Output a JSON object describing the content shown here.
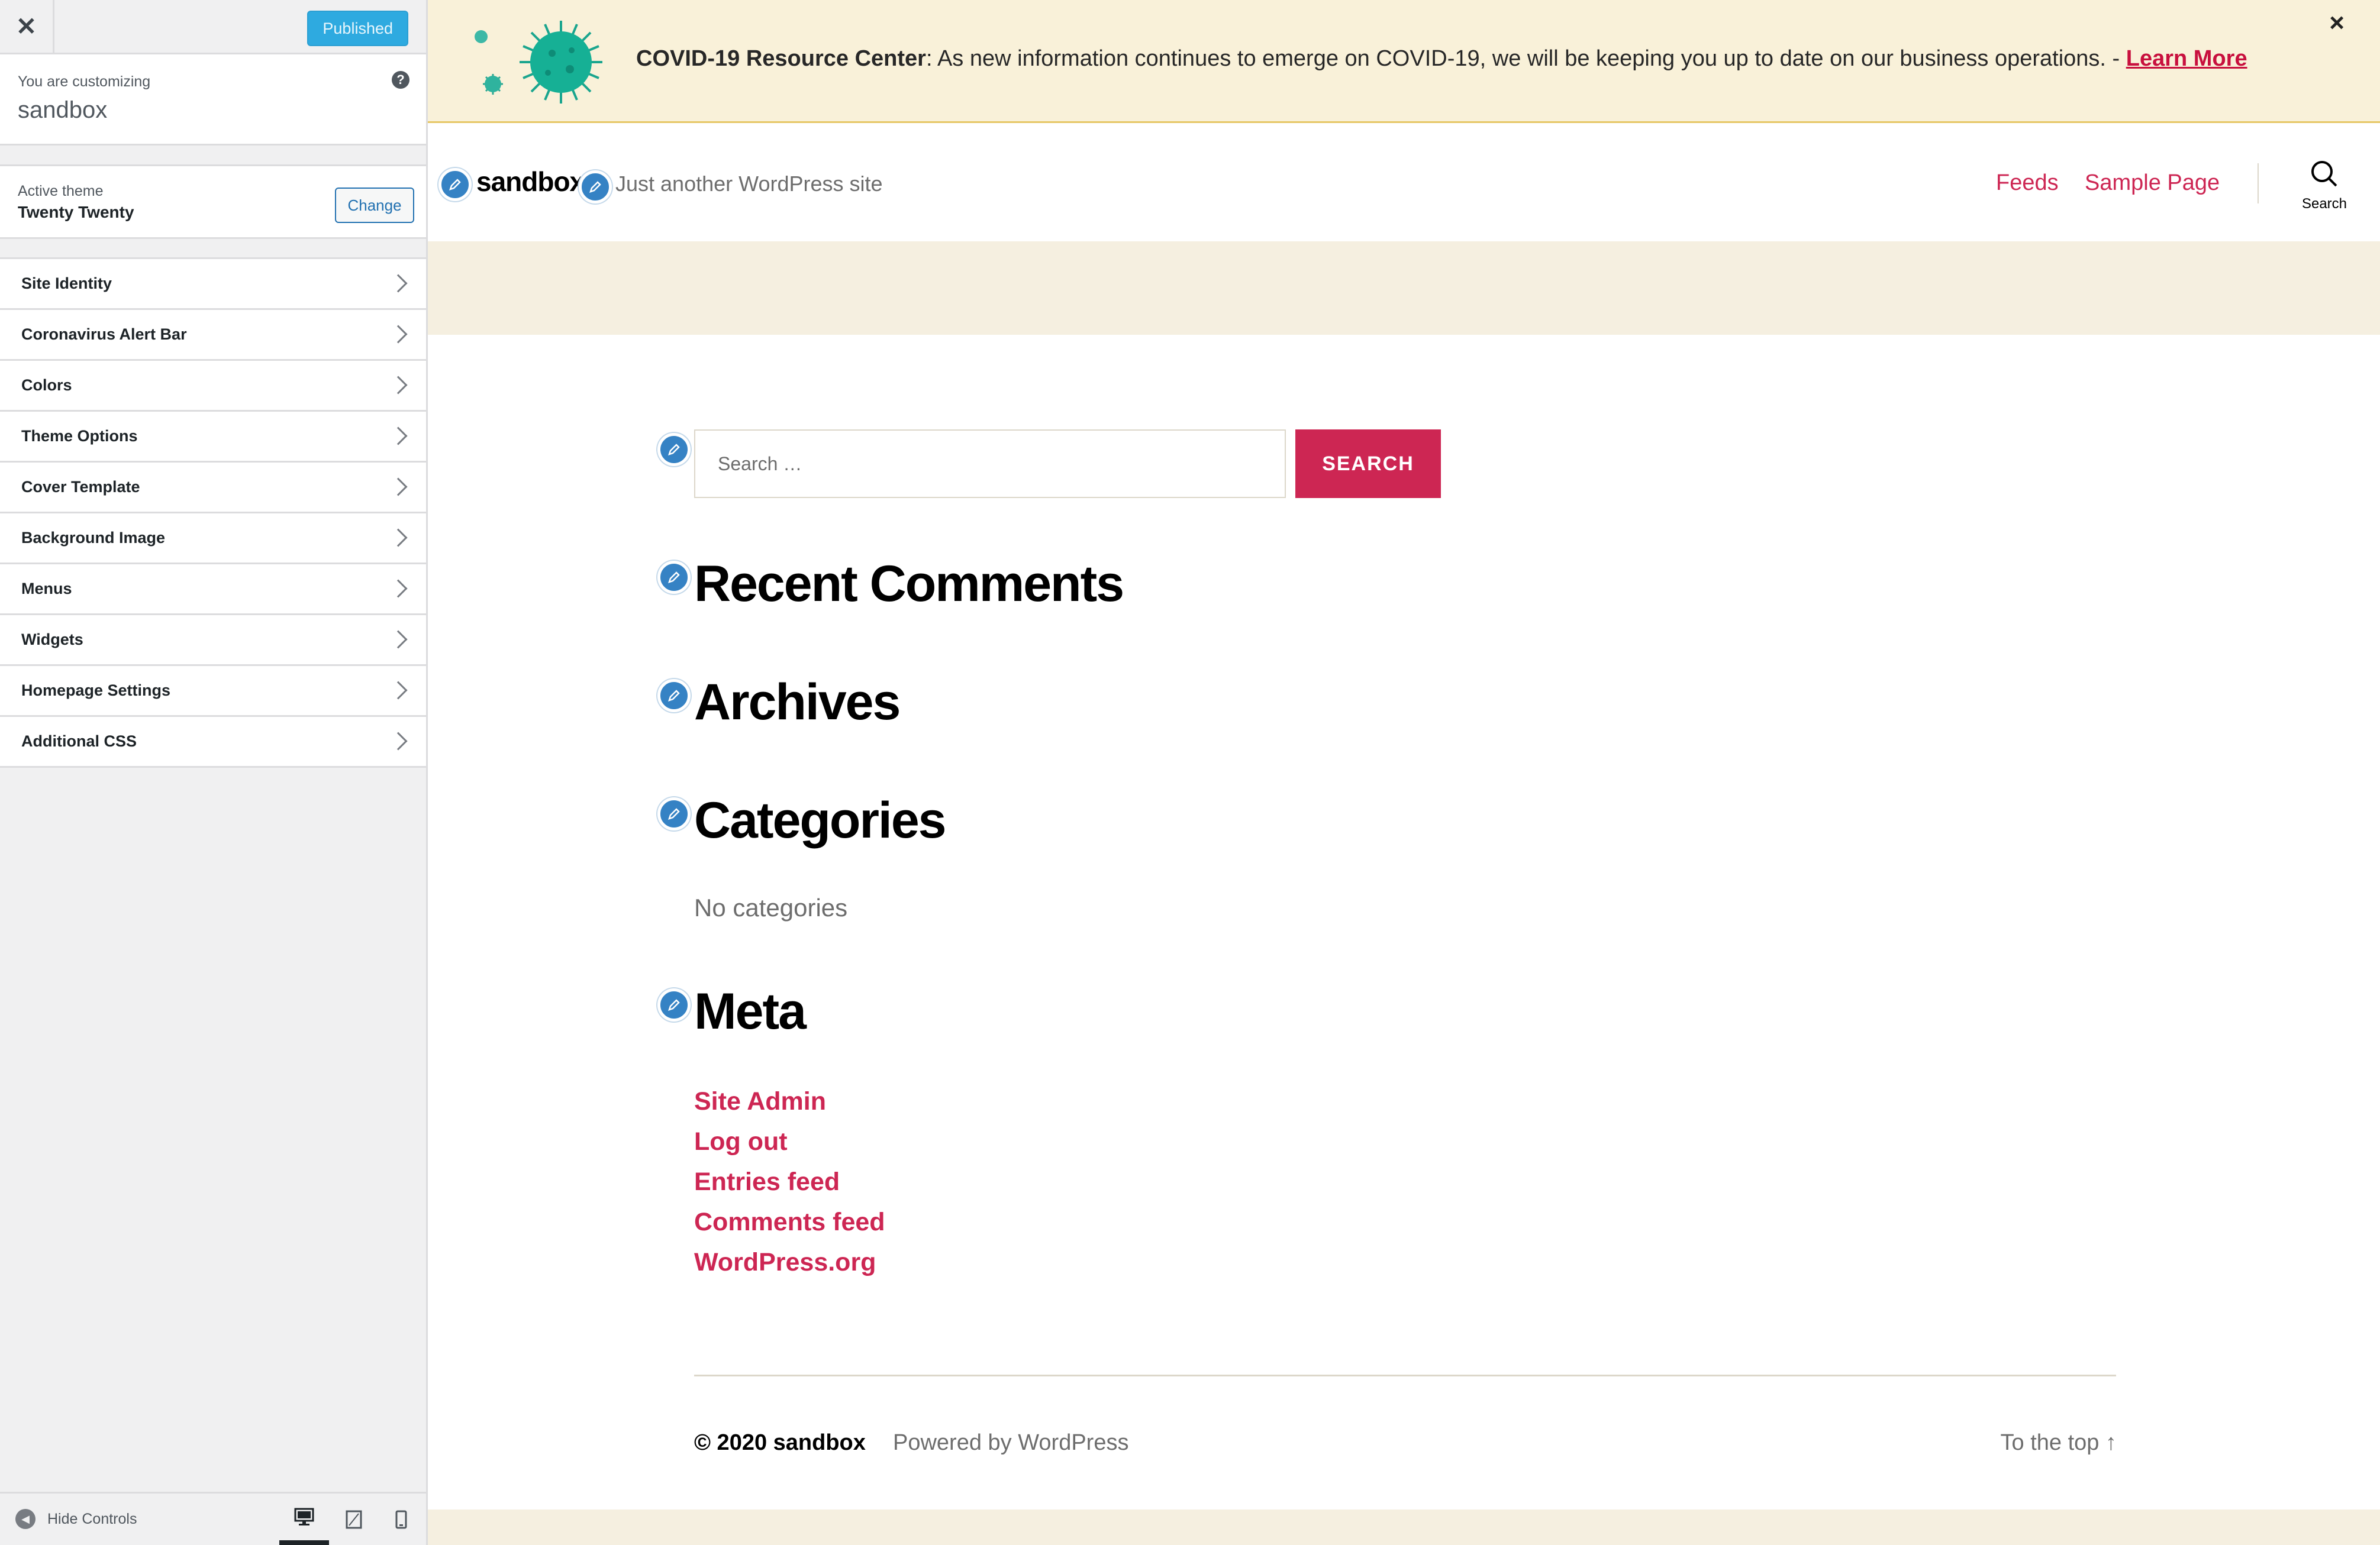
{
  "customizer": {
    "close_icon": "close-icon",
    "publish_button": "Published",
    "customizing_label": "You are customizing",
    "site_name": "sandbox",
    "help_icon": "?",
    "active_theme_label": "Active theme",
    "active_theme_name": "Twenty Twenty",
    "change_button": "Change",
    "menu_items": [
      {
        "label": "Site Identity"
      },
      {
        "label": "Coronavirus Alert Bar"
      },
      {
        "label": "Colors"
      },
      {
        "label": "Theme Options"
      },
      {
        "label": "Cover Template"
      },
      {
        "label": "Background Image"
      },
      {
        "label": "Menus"
      },
      {
        "label": "Widgets"
      },
      {
        "label": "Homepage Settings"
      },
      {
        "label": "Additional CSS"
      }
    ],
    "hide_controls": "Hide Controls",
    "devices": [
      "desktop-icon",
      "tablet-icon",
      "mobile-icon"
    ]
  },
  "alert": {
    "title": "COVID-19 Resource Center",
    "message": ": As new information continues to emerge on COVID-19, we will be keeping you up to date on our business operations. - ",
    "link": "Learn More",
    "close": "×"
  },
  "site": {
    "title": "sandbox",
    "description": "Just another WordPress site",
    "nav": [
      "Feeds",
      "Sample Page"
    ],
    "search_label": "Search"
  },
  "widgets": {
    "search_placeholder": "Search …",
    "search_button": "SEARCH",
    "recent_comments": "Recent Comments",
    "archives": "Archives",
    "categories": "Categories",
    "no_categories": "No categories",
    "meta": "Meta",
    "meta_links": [
      "Site Admin",
      "Log out",
      "Entries feed",
      "Comments feed",
      "WordPress.org"
    ]
  },
  "footer": {
    "copyright": "© 2020 sandbox",
    "powered": "Powered by WordPress",
    "to_top": "To the top ↑"
  },
  "colors": {
    "accent": "#cd2653",
    "wp_blue": "#2271b1",
    "alert_bg": "#f9f1d9",
    "beige": "#f5efe0"
  }
}
